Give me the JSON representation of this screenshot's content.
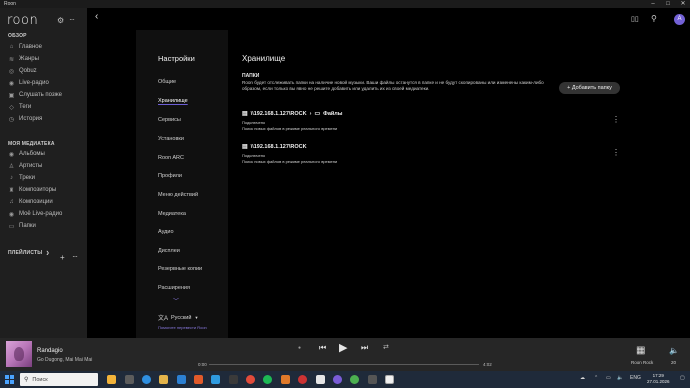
{
  "window": {
    "title": "Roon",
    "controls": [
      "–",
      "□",
      "✕"
    ]
  },
  "sidebar": {
    "logo": "roon",
    "section_overview": "ОБЗОР",
    "overview_items": [
      {
        "label": "Главное",
        "icon": "home-icon"
      },
      {
        "label": "Жанры",
        "icon": "genres-icon"
      },
      {
        "label": "Qobuz",
        "icon": "qobuz-icon"
      },
      {
        "label": "Live-радио",
        "icon": "radio-icon"
      },
      {
        "label": "Слушать позже",
        "icon": "bookmark-icon"
      },
      {
        "label": "Теги",
        "icon": "tag-icon"
      },
      {
        "label": "История",
        "icon": "history-icon"
      }
    ],
    "section_library": "МОЯ МЕДИАТЕКА",
    "library_items": [
      {
        "label": "Альбомы",
        "icon": "album-icon"
      },
      {
        "label": "Артисты",
        "icon": "artist-icon"
      },
      {
        "label": "Треки",
        "icon": "track-icon"
      },
      {
        "label": "Композиторы",
        "icon": "composer-icon"
      },
      {
        "label": "Композиции",
        "icon": "composition-icon"
      },
      {
        "label": "Моё Live-радио",
        "icon": "my-radio-icon"
      },
      {
        "label": "Папки",
        "icon": "folder-icon"
      }
    ],
    "playlists_label": "ПЛЕЙЛИСТЫ",
    "playlists_chevron": "❯"
  },
  "settings": {
    "heading": "Настройки",
    "nav": [
      "Общие",
      "Хранилище",
      "Сервисы",
      "Установки",
      "Roon ARC",
      "Профили",
      "Меню действий",
      "Медиатека",
      "Аудио",
      "Дисплеи",
      "Резервные копии",
      "Расширения"
    ],
    "active": "Хранилище",
    "language": "Русский",
    "help_link": "Помогите перевести Roon"
  },
  "storage": {
    "title": "Хранилище",
    "subtitle": "ПАПКИ",
    "description": "Roon будет отслеживать папки на наличие новой музыки. Ваши файлы останутся в папке и не будут скопированы или изменены каким-либо образом, если только вы явно не решите добавить или удалить их из своей медиатеки.",
    "add_button": "Добавить папку",
    "folders": [
      {
        "path": "\\\\192.168.1.127\\ROCK",
        "subfolder": "Файлы",
        "status": "Подключено",
        "note": "Поиск новых файлов в режиме реального времени"
      },
      {
        "path": "\\\\192.168.1.127\\ROCK",
        "subfolder": "",
        "status": "Подключено",
        "note": "Поиск новых файлов в режиме реального времени"
      }
    ]
  },
  "player": {
    "song": "Randagio",
    "artist": "Go Dugong, Mai Mai Mai",
    "time_elapsed": "0:00",
    "time_total": "4:02",
    "progress": 0,
    "zone": "Roon Rock",
    "volume": "20"
  },
  "taskbar": {
    "search_placeholder": "Поиск",
    "language": "ENG",
    "time": "17:29",
    "date": "27.01.2026"
  },
  "colors": {
    "accent": "#7361d6",
    "sidebar": "#1f1f1f",
    "background": "#000000"
  }
}
